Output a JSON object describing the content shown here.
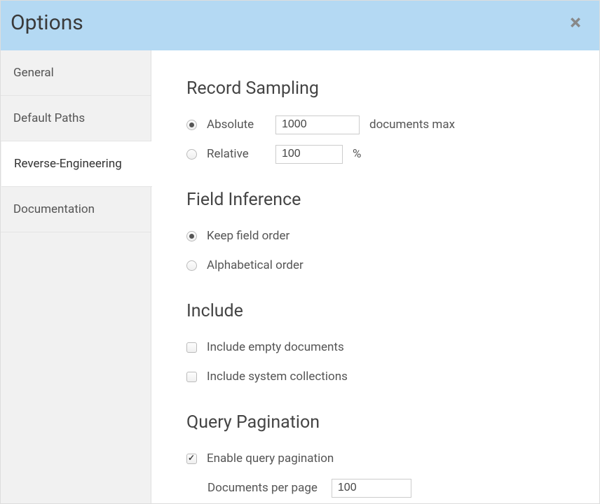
{
  "dialog": {
    "title": "Options"
  },
  "sidebar": {
    "items": [
      {
        "label": "General"
      },
      {
        "label": "Default Paths"
      },
      {
        "label": "Reverse-Engineering"
      },
      {
        "label": "Documentation"
      }
    ],
    "active_index": 2
  },
  "sections": {
    "recordSampling": {
      "heading": "Record Sampling",
      "absolute": {
        "label": "Absolute",
        "value": "1000",
        "suffix": "documents max",
        "selected": true
      },
      "relative": {
        "label": "Relative",
        "value": "100",
        "suffix": "%",
        "selected": false
      }
    },
    "fieldInference": {
      "heading": "Field Inference",
      "keepOrder": {
        "label": "Keep field order",
        "selected": true
      },
      "alphaOrder": {
        "label": "Alphabetical order",
        "selected": false
      }
    },
    "include": {
      "heading": "Include",
      "emptyDocs": {
        "label": "Include empty documents",
        "checked": false
      },
      "systemColl": {
        "label": "Include system collections",
        "checked": false
      }
    },
    "queryPagination": {
      "heading": "Query Pagination",
      "enable": {
        "label": "Enable query pagination",
        "checked": true
      },
      "perPage": {
        "label": "Documents per page",
        "value": "100"
      }
    }
  }
}
